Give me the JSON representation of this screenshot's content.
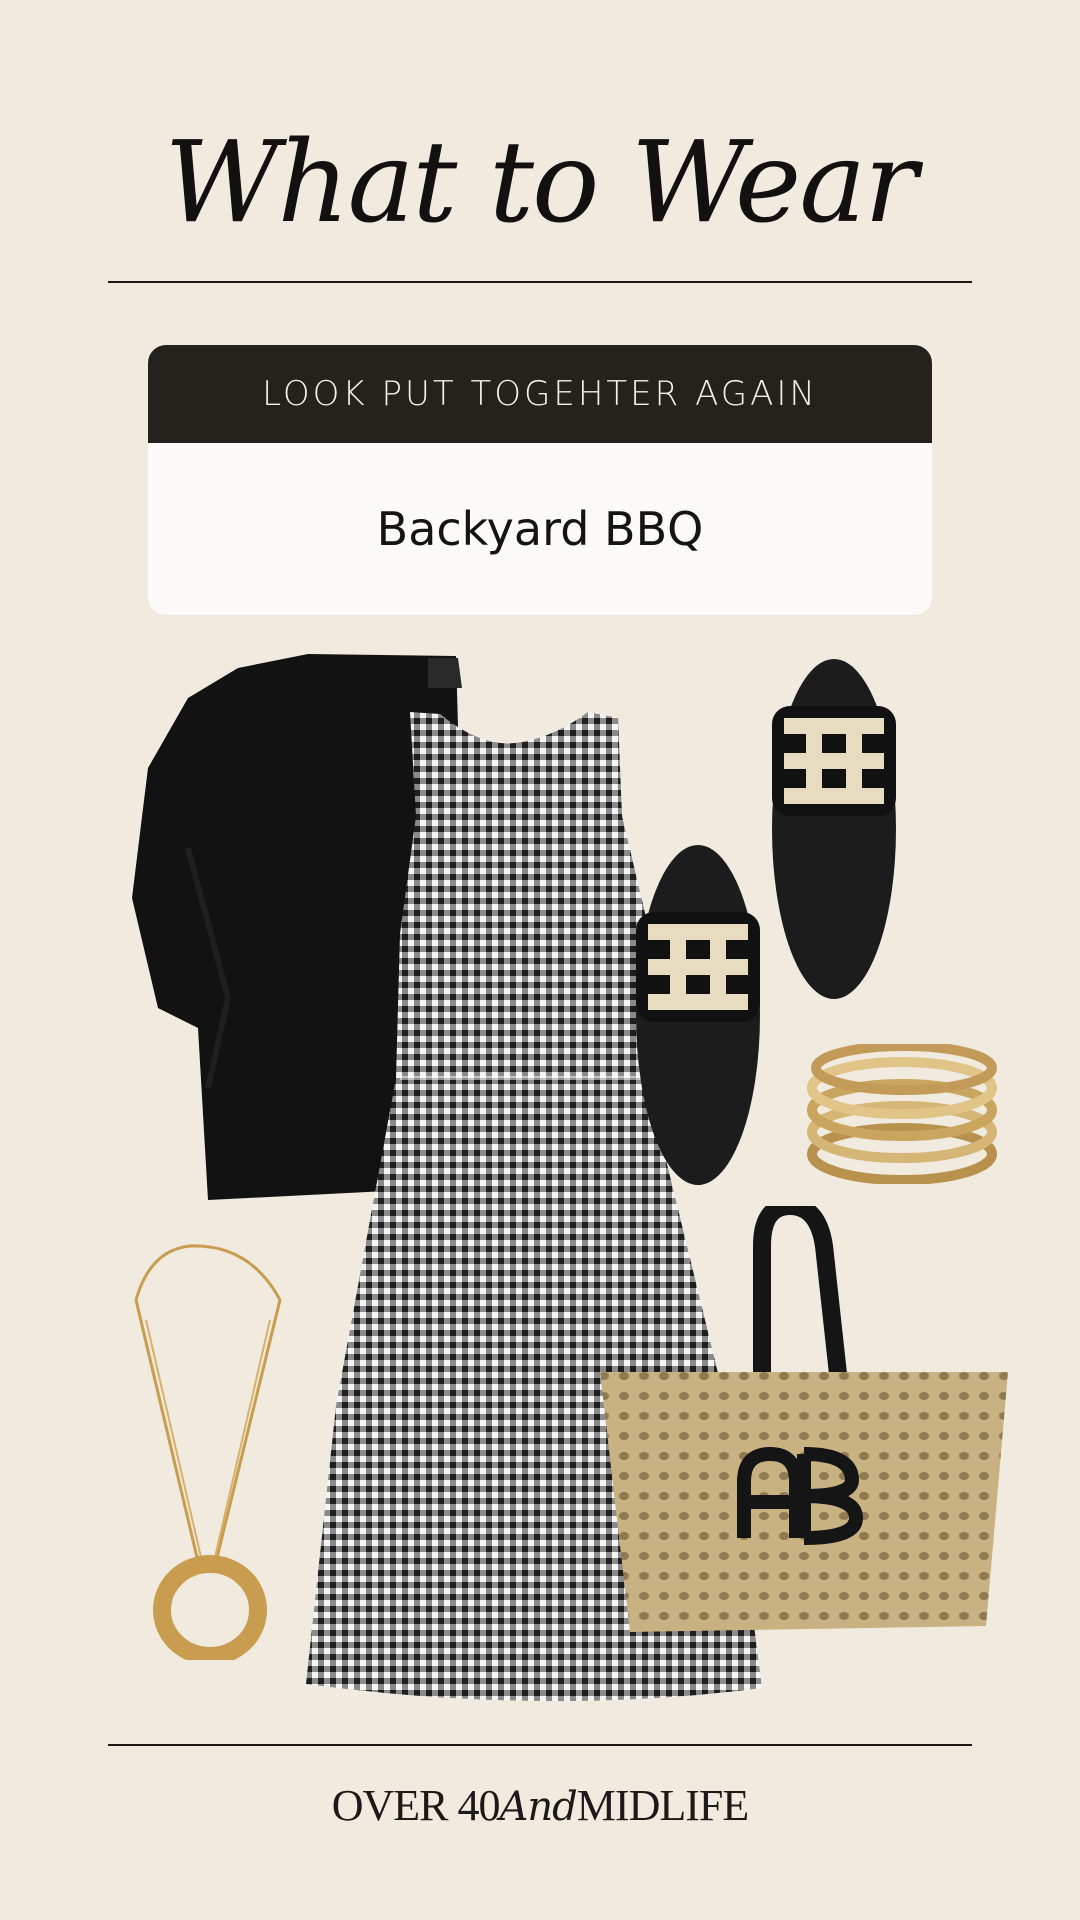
{
  "header": {
    "title": "What to Wear"
  },
  "card": {
    "label": "LOOK PUT TOGEHTER AGAIN",
    "occasion": "Backyard BBQ"
  },
  "items": [
    {
      "icon": "cardigan-icon",
      "color": "#121212"
    },
    {
      "icon": "dress-icon",
      "color": "#2b2b2b"
    },
    {
      "icon": "sandal-icon",
      "color": "#1c1c1c"
    },
    {
      "icon": "bangles-icon",
      "color": "#c9a55e"
    },
    {
      "icon": "necklace-icon",
      "color": "#c99d4f"
    },
    {
      "icon": "tote-bag-icon",
      "color": "#c9b282"
    }
  ],
  "footer": {
    "brand_left": "OVER 40",
    "brand_mid": "And",
    "brand_right": "MIDLIFE"
  }
}
